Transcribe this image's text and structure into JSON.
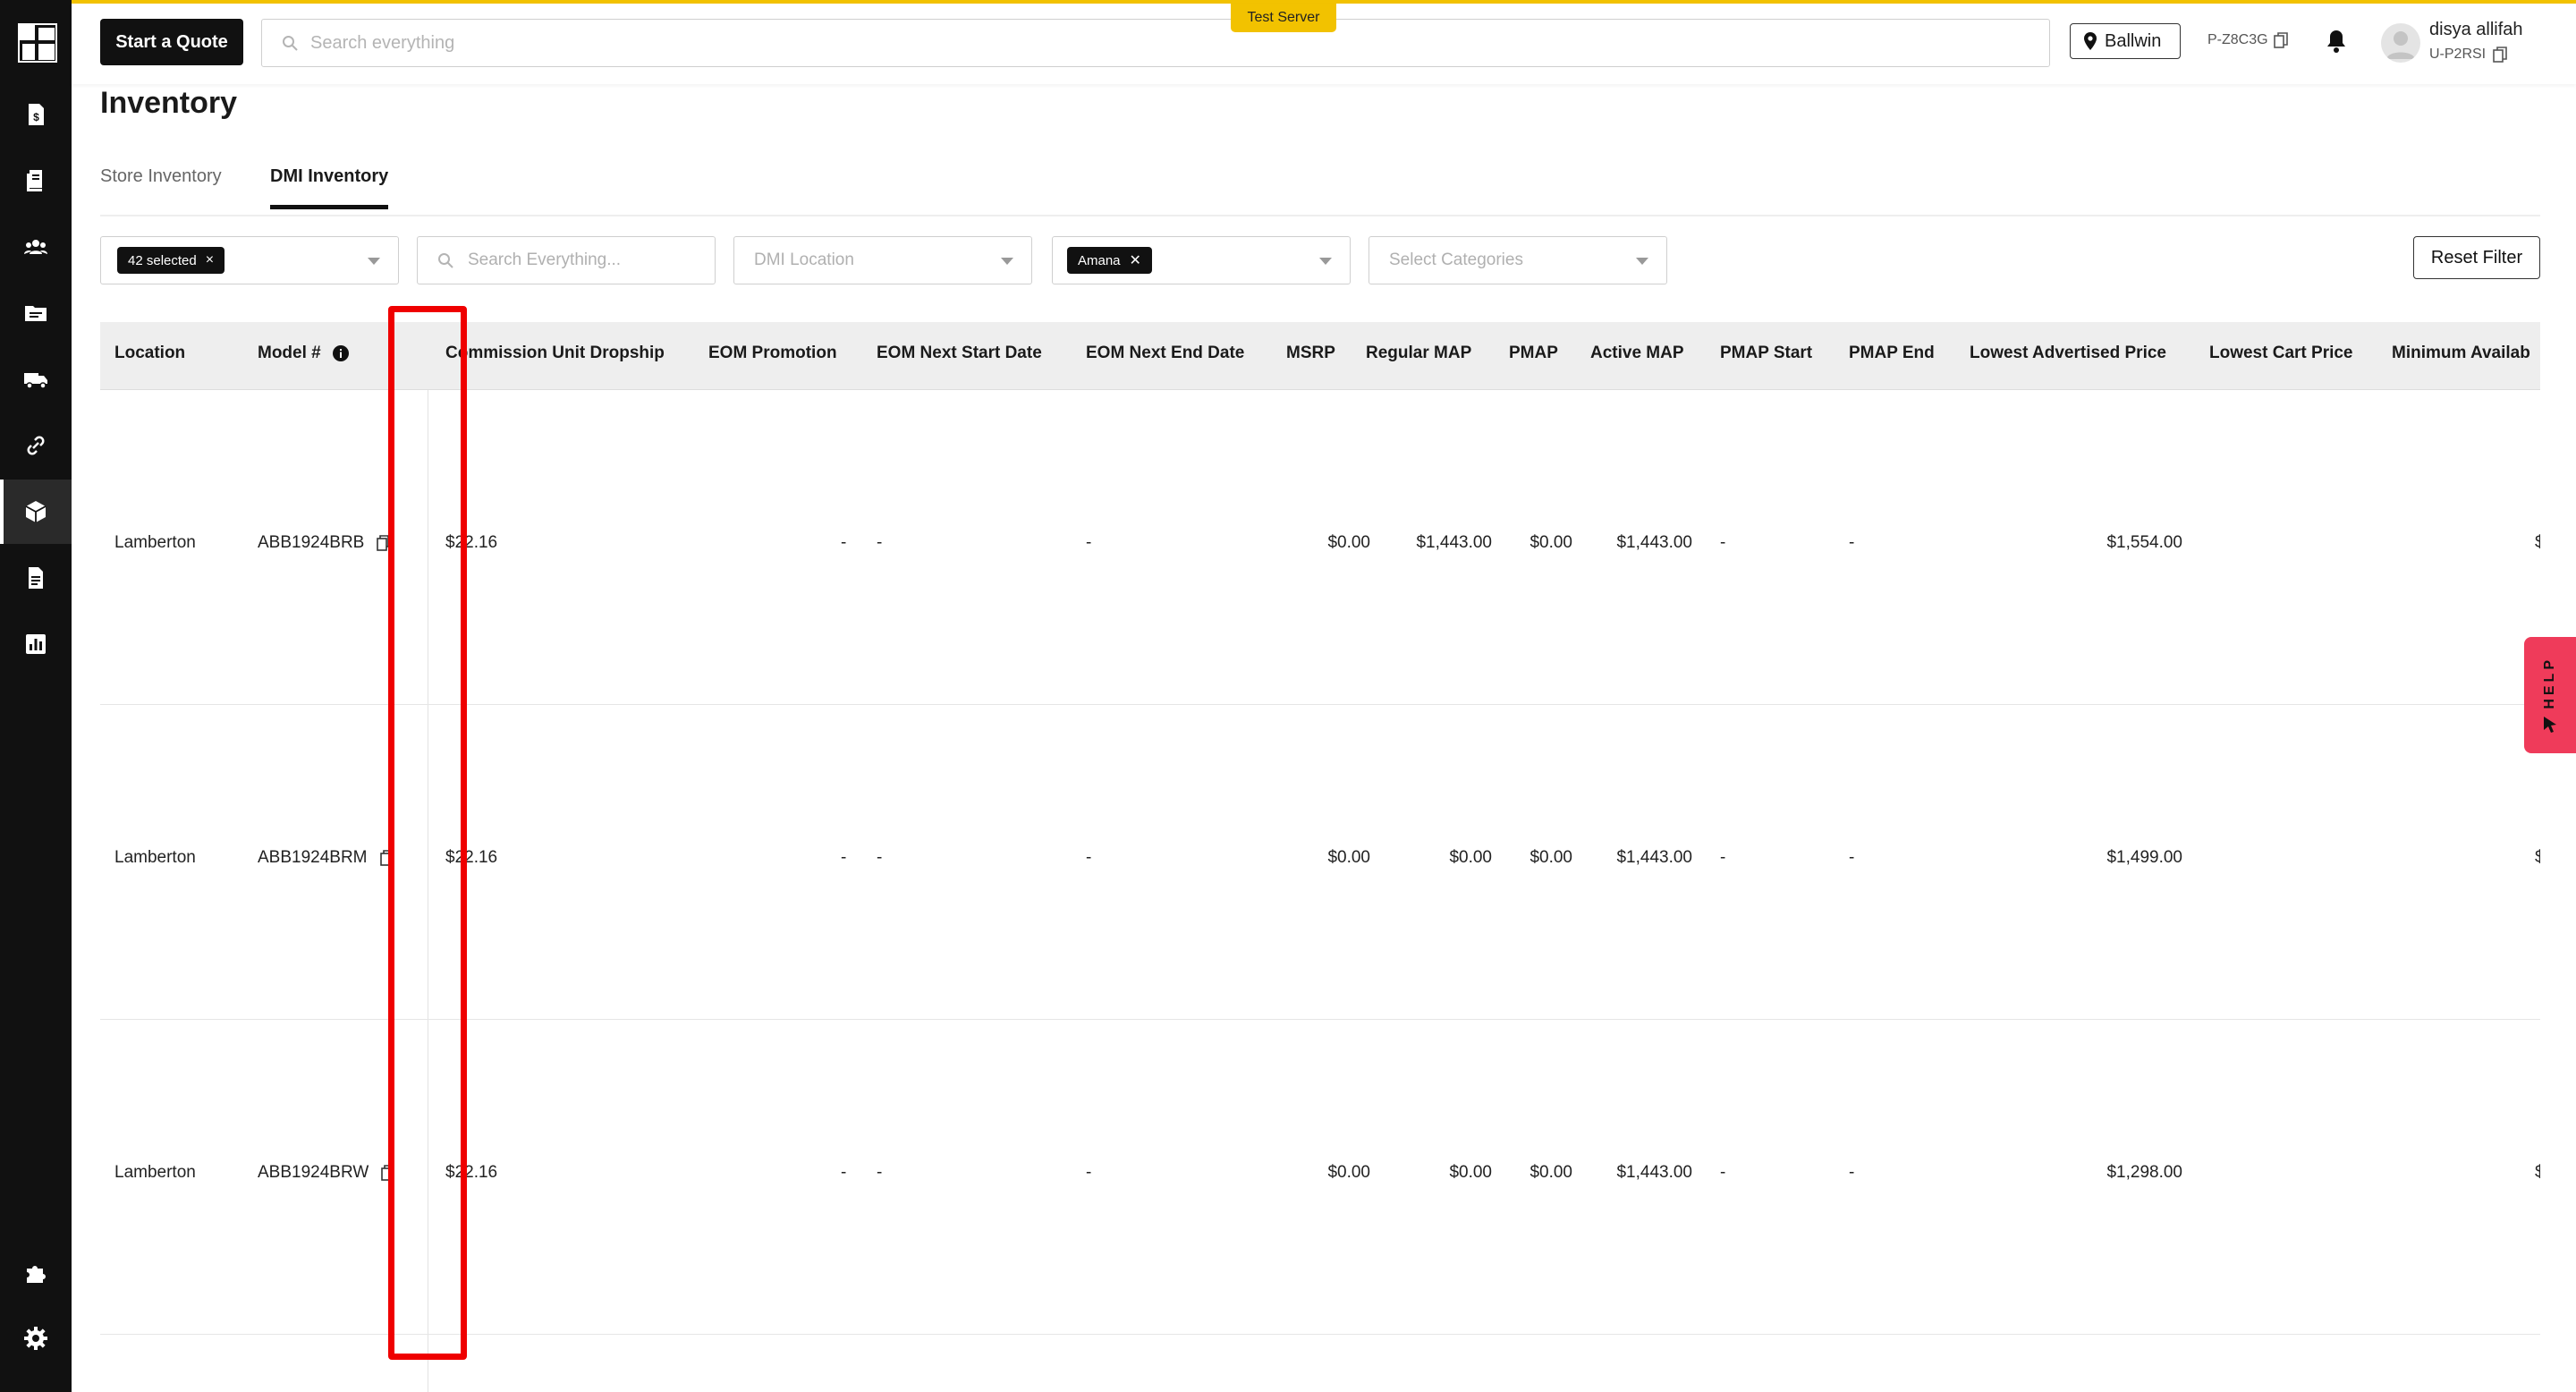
{
  "header": {
    "start_quote": "Start a Quote",
    "search_placeholder": "Search everything",
    "test_server": "Test Server",
    "location": "Ballwin",
    "store_code": "P-Z8C3G",
    "user_name": "disya allifah",
    "user_id": "U-P2RSI"
  },
  "page": {
    "title": "Inventory",
    "tabs": [
      {
        "label": "Store Inventory",
        "active": false
      },
      {
        "label": "DMI Inventory",
        "active": true
      }
    ]
  },
  "filters": {
    "selected_chip": "42 selected",
    "search_placeholder": "Search Everything...",
    "dmi_location_placeholder": "DMI Location",
    "brand_chip": "Amana",
    "categories_placeholder": "Select Categories",
    "reset_label": "Reset Filter"
  },
  "table": {
    "columns": [
      "Location",
      "Model #",
      "Commission Unit Dropship",
      "EOM Promotion",
      "EOM Next Start Date",
      "EOM Next End Date",
      "MSRP",
      "Regular MAP",
      "PMAP",
      "Active MAP",
      "PMAP Start",
      "PMAP End",
      "Lowest Advertised Price",
      "Lowest Cart Price",
      "Minimum Availab"
    ],
    "rows": [
      {
        "location": "Lamberton",
        "model": "ABB1924BRB",
        "commission": "$22.16",
        "eom_promotion": "-",
        "eom_next_start": "-",
        "eom_next_end": "-",
        "msrp": "$0.00",
        "regular_map": "$1,443.00",
        "pmap": "$0.00",
        "active_map": "$1,443.00",
        "pmap_start": "-",
        "pmap_end": "-",
        "lowest_advertised": "$1,554.00",
        "lowest_cart": "",
        "minimum_available": "$"
      },
      {
        "location": "Lamberton",
        "model": "ABB1924BRM",
        "commission": "$22.16",
        "eom_promotion": "-",
        "eom_next_start": "-",
        "eom_next_end": "-",
        "msrp": "$0.00",
        "regular_map": "$0.00",
        "pmap": "$0.00",
        "active_map": "$1,443.00",
        "pmap_start": "-",
        "pmap_end": "-",
        "lowest_advertised": "$1,499.00",
        "lowest_cart": "",
        "minimum_available": "$"
      },
      {
        "location": "Lamberton",
        "model": "ABB1924BRW",
        "commission": "$22.16",
        "eom_promotion": "-",
        "eom_next_start": "-",
        "eom_next_end": "-",
        "msrp": "$0.00",
        "regular_map": "$0.00",
        "pmap": "$0.00",
        "active_map": "$1,443.00",
        "pmap_start": "-",
        "pmap_end": "-",
        "lowest_advertised": "$1,298.00",
        "lowest_cart": "",
        "minimum_available": "$"
      }
    ]
  },
  "help": {
    "label": "HELP"
  },
  "colors": {
    "accent": "#f2c200",
    "highlight": "#ef0000",
    "help": "#ef3b5a",
    "rail": "#111111"
  }
}
